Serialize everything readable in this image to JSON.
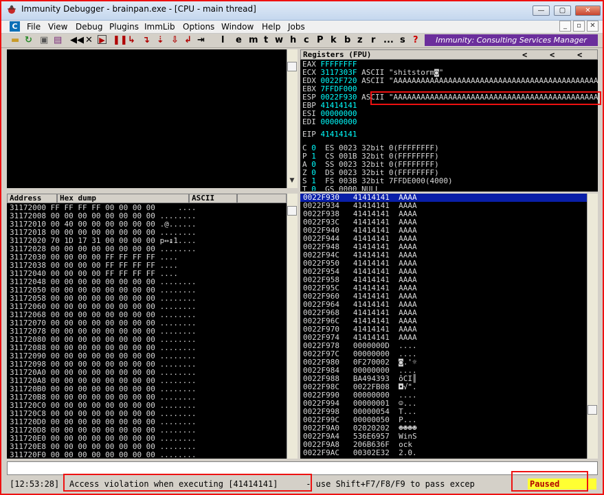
{
  "window": {
    "title": "Immunity Debugger - brainpan.exe - [CPU - main thread]",
    "min_label": "—",
    "max_label": "▢",
    "close_label": "✕"
  },
  "menubar": {
    "items": [
      "File",
      "View",
      "Debug",
      "Plugins",
      "ImmLib",
      "Options",
      "Window",
      "Help",
      "Jobs"
    ],
    "mdi": [
      "_",
      "▫",
      "✕"
    ]
  },
  "toolbar": {
    "letters": [
      "l",
      "e",
      "m",
      "t",
      "w",
      "h",
      "c",
      "P",
      "k",
      "b",
      "z",
      "r",
      "...",
      "s",
      "?"
    ],
    "consulting": "Immunity: Consulting Services Manager"
  },
  "registers": {
    "header": "Registers (FPU)",
    "nav": [
      "<",
      "<",
      "<"
    ],
    "regs": [
      {
        "name": "EAX",
        "value": "FFFFFFFF",
        "comment": ""
      },
      {
        "name": "ECX",
        "value": "3117303F",
        "comment": "ASCII \"shitstorm◙\""
      },
      {
        "name": "EDX",
        "value": "0022F720",
        "comment": "ASCII \"AAAAAAAAAAAAAAAAAAAAAAAAAAAAAAAAAAAAAAAAAAAAAAAAAAAAAAAAAAAAAAAAAAAAAAAAAAAAAAAAAAAAAAAAAAAAAAAAAAAAAAAAAAAAAAAAAAAAAAAAAA"
      },
      {
        "name": "EBX",
        "value": "7FFDF000",
        "comment": ""
      },
      {
        "name": "ESP",
        "value": "0022F930",
        "comment": "ASCII \"AAAAAAAAAAAAAAAAAAAAAAAAAAAAAAAAAAAAAAAAAAAAAAAAAAAAAAAAAAAAAAAAAAAAAAAAAAAAAAAAAAAAAAAAAAAAAAAAAAAAAAAAAAAAAAAAAAAAAAAAAA"
      },
      {
        "name": "EBP",
        "value": "41414141",
        "comment": ""
      },
      {
        "name": "ESI",
        "value": "00000000",
        "comment": ""
      },
      {
        "name": "EDI",
        "value": "00000000",
        "comment": ""
      }
    ],
    "eip": {
      "name": "EIP",
      "value": "41414141"
    },
    "flags": [
      {
        "flag": "C",
        "bit": "0",
        "seg": "ES",
        "sel": "0023",
        "mode": "32bit",
        "desc": "0(FFFFFFFF)"
      },
      {
        "flag": "P",
        "bit": "1",
        "seg": "CS",
        "sel": "001B",
        "mode": "32bit",
        "desc": "0(FFFFFFFF)"
      },
      {
        "flag": "A",
        "bit": "0",
        "seg": "SS",
        "sel": "0023",
        "mode": "32bit",
        "desc": "0(FFFFFFFF)"
      },
      {
        "flag": "Z",
        "bit": "0",
        "seg": "DS",
        "sel": "0023",
        "mode": "32bit",
        "desc": "0(FFFFFFFF)"
      },
      {
        "flag": "S",
        "bit": "1",
        "seg": "FS",
        "sel": "003B",
        "mode": "32bit",
        "desc": "7FFDE000(4000)"
      },
      {
        "flag": "T",
        "bit": "0",
        "seg": "GS",
        "sel": "0000",
        "mode": "NULL",
        "desc": ""
      }
    ]
  },
  "dump": {
    "headers": {
      "address": "Address",
      "hex": "Hex dump",
      "ascii": "ASCII"
    },
    "rows": [
      {
        "addr": "31172000",
        "hex": "FF FF FF FF 00 00 00 00",
        "ascii": "    ...."
      },
      {
        "addr": "31172008",
        "hex": "00 00 00 00 00 00 00 00",
        "ascii": "........"
      },
      {
        "addr": "31172010",
        "hex": "00 40 00 00 00 00 00 00",
        "ascii": ".@......"
      },
      {
        "addr": "31172018",
        "hex": "00 00 00 00 00 00 00 00",
        "ascii": "........"
      },
      {
        "addr": "31172020",
        "hex": "70 1D 17 31 00 00 00 00",
        "ascii": "p↔↨1...."
      },
      {
        "addr": "31172028",
        "hex": "00 00 00 00 00 00 00 00",
        "ascii": "........"
      },
      {
        "addr": "31172030",
        "hex": "00 00 00 00 FF FF FF FF",
        "ascii": "....    "
      },
      {
        "addr": "31172038",
        "hex": "00 00 00 00 FF FF FF FF",
        "ascii": "....    "
      },
      {
        "addr": "31172040",
        "hex": "00 00 00 00 FF FF FF FF",
        "ascii": "....    "
      },
      {
        "addr": "31172048",
        "hex": "00 00 00 00 00 00 00 00",
        "ascii": "........"
      },
      {
        "addr": "31172050",
        "hex": "00 00 00 00 00 00 00 00",
        "ascii": "........"
      },
      {
        "addr": "31172058",
        "hex": "00 00 00 00 00 00 00 00",
        "ascii": "........"
      },
      {
        "addr": "31172060",
        "hex": "00 00 00 00 00 00 00 00",
        "ascii": "........"
      },
      {
        "addr": "31172068",
        "hex": "00 00 00 00 00 00 00 00",
        "ascii": "........"
      },
      {
        "addr": "31172070",
        "hex": "00 00 00 00 00 00 00 00",
        "ascii": "........"
      },
      {
        "addr": "31172078",
        "hex": "00 00 00 00 00 00 00 00",
        "ascii": "........"
      },
      {
        "addr": "31172080",
        "hex": "00 00 00 00 00 00 00 00",
        "ascii": "........"
      },
      {
        "addr": "31172088",
        "hex": "00 00 00 00 00 00 00 00",
        "ascii": "........"
      },
      {
        "addr": "31172090",
        "hex": "00 00 00 00 00 00 00 00",
        "ascii": "........"
      },
      {
        "addr": "31172098",
        "hex": "00 00 00 00 00 00 00 00",
        "ascii": "........"
      },
      {
        "addr": "311720A0",
        "hex": "00 00 00 00 00 00 00 00",
        "ascii": "........"
      },
      {
        "addr": "311720A8",
        "hex": "00 00 00 00 00 00 00 00",
        "ascii": "........"
      },
      {
        "addr": "311720B0",
        "hex": "00 00 00 00 00 00 00 00",
        "ascii": "........"
      },
      {
        "addr": "311720B8",
        "hex": "00 00 00 00 00 00 00 00",
        "ascii": "........"
      },
      {
        "addr": "311720C0",
        "hex": "00 00 00 00 00 00 00 00",
        "ascii": "........"
      },
      {
        "addr": "311720C8",
        "hex": "00 00 00 00 00 00 00 00",
        "ascii": "........"
      },
      {
        "addr": "311720D0",
        "hex": "00 00 00 00 00 00 00 00",
        "ascii": "........"
      },
      {
        "addr": "311720D8",
        "hex": "00 00 00 00 00 00 00 00",
        "ascii": "........"
      },
      {
        "addr": "311720E0",
        "hex": "00 00 00 00 00 00 00 00",
        "ascii": "........"
      },
      {
        "addr": "311720E8",
        "hex": "00 00 00 00 00 00 00 00",
        "ascii": "........"
      },
      {
        "addr": "311720F0",
        "hex": "00 00 00 00 00 00 00 00",
        "ascii": "........"
      }
    ]
  },
  "stack": {
    "rows": [
      {
        "addr": "0022F930",
        "val": "41414141",
        "text": "AAAA",
        "selected": true
      },
      {
        "addr": "0022F934",
        "val": "41414141",
        "text": "AAAA"
      },
      {
        "addr": "0022F938",
        "val": "41414141",
        "text": "AAAA"
      },
      {
        "addr": "0022F93C",
        "val": "41414141",
        "text": "AAAA"
      },
      {
        "addr": "0022F940",
        "val": "41414141",
        "text": "AAAA"
      },
      {
        "addr": "0022F944",
        "val": "41414141",
        "text": "AAAA"
      },
      {
        "addr": "0022F948",
        "val": "41414141",
        "text": "AAAA"
      },
      {
        "addr": "0022F94C",
        "val": "41414141",
        "text": "AAAA"
      },
      {
        "addr": "0022F950",
        "val": "41414141",
        "text": "AAAA"
      },
      {
        "addr": "0022F954",
        "val": "41414141",
        "text": "AAAA"
      },
      {
        "addr": "0022F958",
        "val": "41414141",
        "text": "AAAA"
      },
      {
        "addr": "0022F95C",
        "val": "41414141",
        "text": "AAAA"
      },
      {
        "addr": "0022F960",
        "val": "41414141",
        "text": "AAAA"
      },
      {
        "addr": "0022F964",
        "val": "41414141",
        "text": "AAAA"
      },
      {
        "addr": "0022F968",
        "val": "41414141",
        "text": "AAAA"
      },
      {
        "addr": "0022F96C",
        "val": "41414141",
        "text": "AAAA"
      },
      {
        "addr": "0022F970",
        "val": "41414141",
        "text": "AAAA"
      },
      {
        "addr": "0022F974",
        "val": "41414141",
        "text": "AAAA"
      },
      {
        "addr": "0022F978",
        "val": "0000000D",
        "text": "...."
      },
      {
        "addr": "0022F97C",
        "val": "00000000",
        "text": "...."
      },
      {
        "addr": "0022F980",
        "val": "0F270002",
        "text": "◙.'☼"
      },
      {
        "addr": "0022F984",
        "val": "00000000",
        "text": "...."
      },
      {
        "addr": "0022F988",
        "val": "BA494393",
        "text": "ôCI║"
      },
      {
        "addr": "0022F98C",
        "val": "0022FB08",
        "text": "◘√\"."
      },
      {
        "addr": "0022F990",
        "val": "00000000",
        "text": "...."
      },
      {
        "addr": "0022F994",
        "val": "00000001",
        "text": "☺..."
      },
      {
        "addr": "0022F998",
        "val": "00000054",
        "text": "T..."
      },
      {
        "addr": "0022F99C",
        "val": "00000050",
        "text": "P..."
      },
      {
        "addr": "0022F9A0",
        "val": "02020202",
        "text": "☻☻☻☻"
      },
      {
        "addr": "0022F9A4",
        "val": "536E6957",
        "text": "WinS"
      },
      {
        "addr": "0022F9A8",
        "val": "206B636F",
        "text": "ock "
      },
      {
        "addr": "0022F9AC",
        "val": "00302E32",
        "text": "2.0."
      }
    ]
  },
  "status": {
    "time": "[12:53:28]",
    "message": "Access violation when executing [41414141]",
    "hint": " - use Shift+F7/F8/F9 to pass excep",
    "state": "Paused"
  }
}
